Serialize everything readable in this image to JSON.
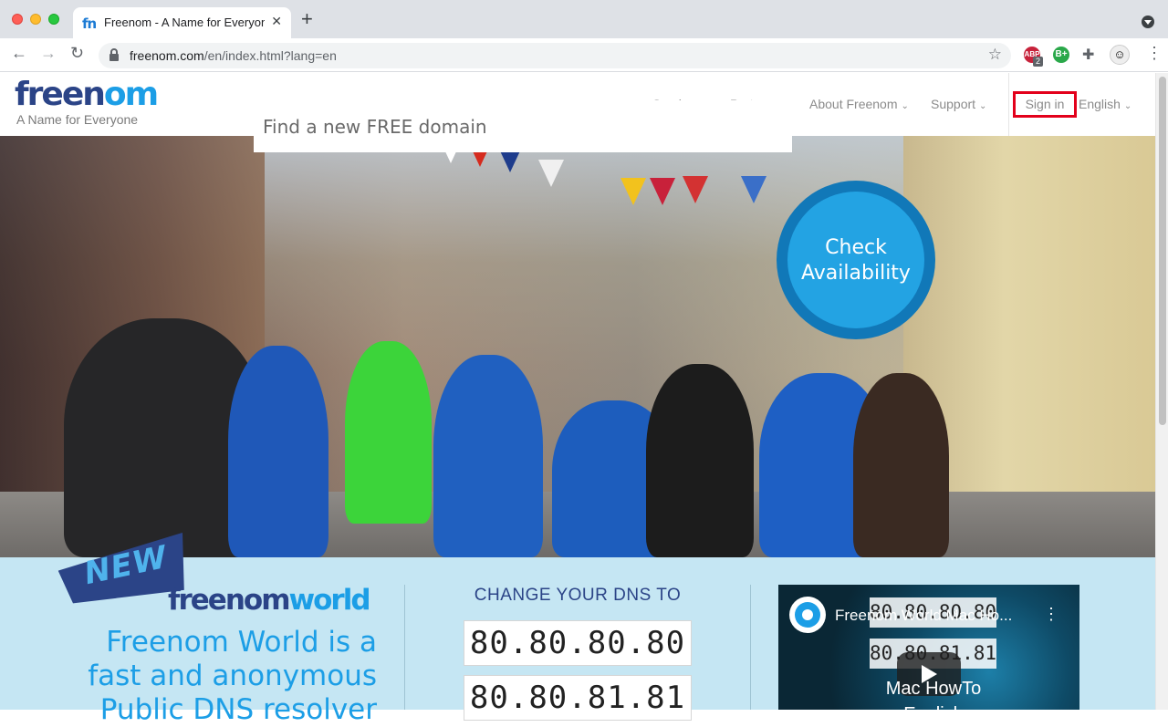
{
  "browser": {
    "tab_title": "Freenom - A Name for Everyone",
    "tab_favicon": "fn",
    "tab_close": "✕",
    "new_tab": "+",
    "url_host": "freenom.com",
    "url_path": "/en/index.html?lang=en",
    "ext_abp_label": "ABP",
    "ext_abp_badge": "2",
    "ext_b_label": "B+"
  },
  "header": {
    "logo_main": "freen",
    "logo_accent": "om",
    "tagline": "A Name for Everyone",
    "nav": {
      "services": "Services",
      "partners": "Partners",
      "about": "About Freenom",
      "support": "Support",
      "signin": "Sign in",
      "language": "English"
    }
  },
  "hero": {
    "search_placeholder": "Find a new FREE domain",
    "check_line1": "Check",
    "check_line2": "Availability"
  },
  "freenom_world": {
    "badge": "NEW",
    "logo_a": "freenom",
    "logo_b": "world",
    "text_line1": "Freenom World is a",
    "text_line2": "fast and anonymous",
    "text_line3": "Public DNS resolver"
  },
  "dns": {
    "heading": "CHANGE YOUR DNS TO",
    "primary": "80.80.80.80",
    "secondary": "80.80.81.81"
  },
  "video": {
    "title": "Freenom World Mac Ho...",
    "ip1": "80.80.80.80",
    "ip2": "80.80.81.81",
    "caption_line1": "Mac HowTo",
    "caption_line2": "English"
  },
  "colors": {
    "brand_navy": "#2b4487",
    "brand_blue": "#1c9ee6",
    "signin_highlight": "#e3001b",
    "lower_bg": "#c5e6f3"
  }
}
